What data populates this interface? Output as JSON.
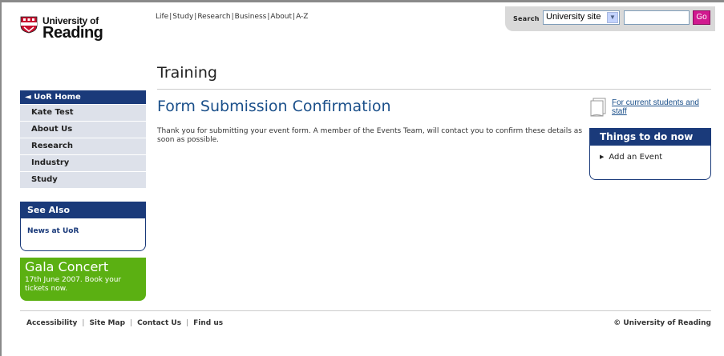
{
  "logo": {
    "line1": "University of",
    "line2": "Reading"
  },
  "topnav": [
    "Life",
    "Study",
    "Research",
    "Business",
    "About",
    "A-Z"
  ],
  "search": {
    "label": "Search",
    "scope": "University site",
    "query": "",
    "go": "Go"
  },
  "section_title": "Training",
  "leftnav": {
    "home": "◄ UoR Home",
    "items": [
      "Kate Test",
      "About Us",
      "Research",
      "Industry",
      "Study"
    ]
  },
  "see_also": {
    "heading": "See Also",
    "link": "News at UoR"
  },
  "promo": {
    "title": "Gala Concert",
    "text": "17th June 2007. Book your tickets now."
  },
  "main": {
    "heading": "Form Submission Confirmation",
    "body": "Thank you for submitting your event form. A member of the Events Team, will contact you to confirm these details as soon as possible."
  },
  "right": {
    "students_link": "For current students and staff",
    "todo_heading": "Things to do now",
    "todo_items": [
      "Add an Event"
    ]
  },
  "footer": {
    "links": [
      "Accessibility",
      "Site Map",
      "Contact Us",
      "Find us"
    ],
    "copyright": "© University of Reading"
  },
  "colors": {
    "brand_navy": "#1a3a7a",
    "heading_blue": "#1a4f8a",
    "promo_green": "#5bb012",
    "go_magenta": "#d1198f",
    "nav_bg": "#dde1ea"
  }
}
